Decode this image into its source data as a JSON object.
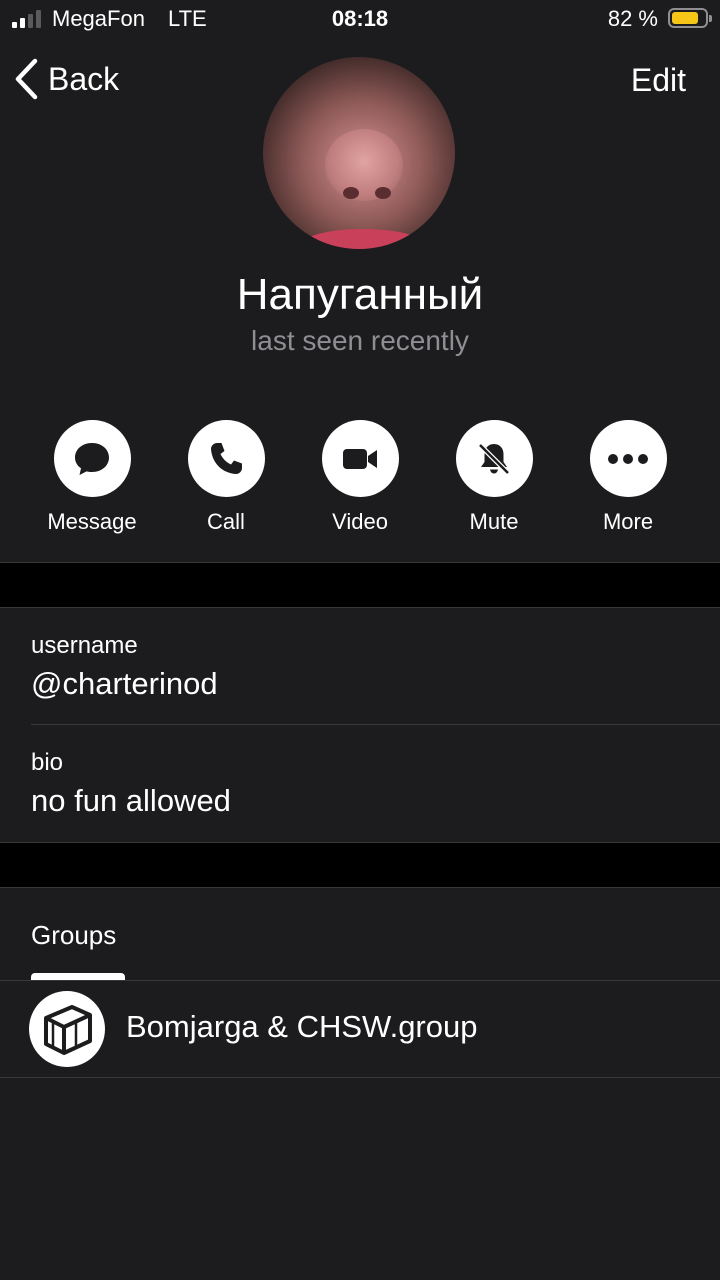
{
  "status_bar": {
    "carrier": "MegaFon",
    "network": "LTE",
    "time": "08:18",
    "battery_percent": "82 %",
    "battery_level": 0.82,
    "signal_bars": 2
  },
  "nav": {
    "back_label": "Back",
    "edit_label": "Edit"
  },
  "profile": {
    "name": "Напуганный",
    "last_seen": "last seen recently"
  },
  "actions": [
    {
      "label": "Message",
      "icon": "message-bubble-icon"
    },
    {
      "label": "Call",
      "icon": "phone-icon"
    },
    {
      "label": "Video",
      "icon": "video-camera-icon"
    },
    {
      "label": "Mute",
      "icon": "bell-slash-icon"
    },
    {
      "label": "More",
      "icon": "ellipsis-icon"
    }
  ],
  "info": {
    "username_label": "username",
    "username_value": "@charterinod",
    "bio_label": "bio",
    "bio_value": "no fun allowed"
  },
  "groups": {
    "tab_label": "Groups",
    "items": [
      {
        "name": "Bomjarga & CHSW.group",
        "icon": "cube-icon"
      }
    ]
  },
  "colors": {
    "background": "#1c1c1e",
    "separator_band": "#000000",
    "battery_fill": "#f5c518",
    "secondary_text": "#8e8e93"
  }
}
